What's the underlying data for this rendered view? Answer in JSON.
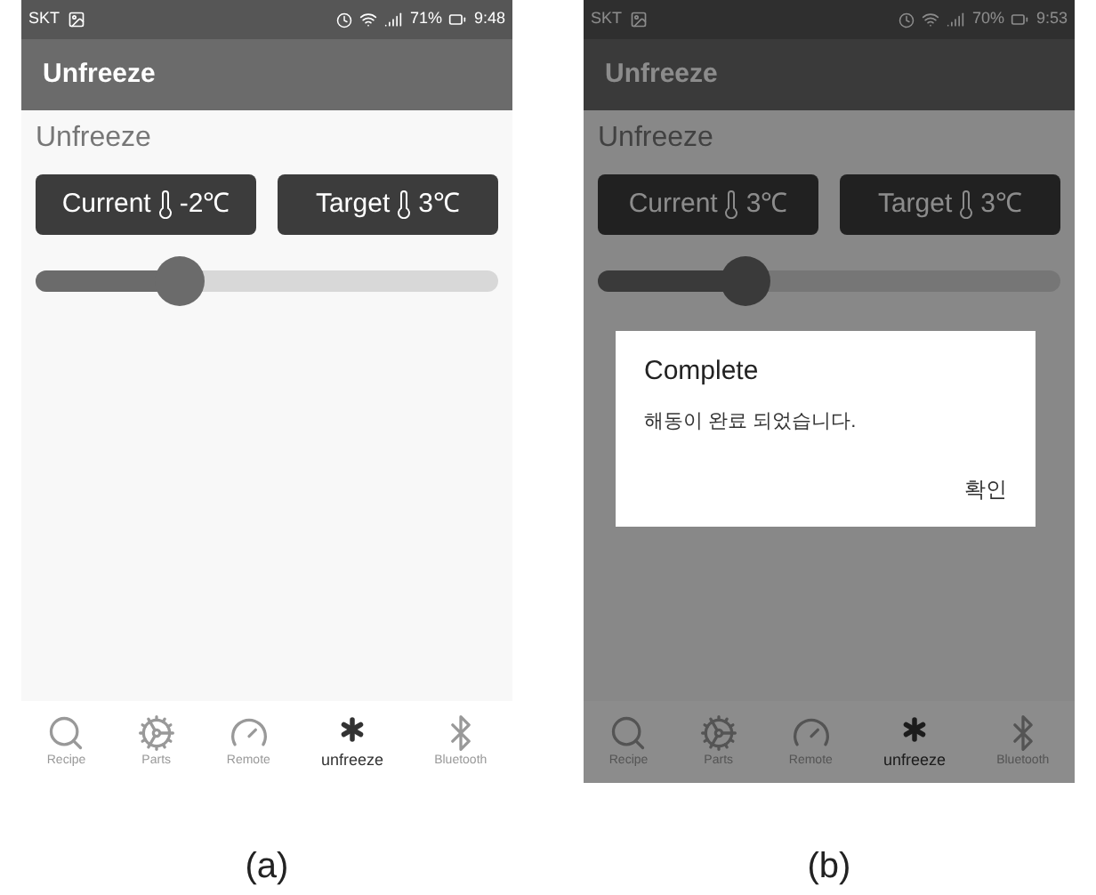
{
  "figures": [
    {
      "caption": "(a)",
      "status_bar": {
        "carrier": "SKT",
        "battery": "71%",
        "time": "9:48"
      },
      "app_bar": {
        "title": "Unfreeze"
      },
      "heading": "Unfreeze",
      "readings": [
        {
          "label": "Current",
          "value": "-2℃"
        },
        {
          "label": "Target",
          "value": "3℃"
        }
      ],
      "slider": {
        "level": 0.31
      },
      "nav": [
        {
          "kind": "search",
          "label": "Recipe",
          "selected": false
        },
        {
          "kind": "gears",
          "label": "Parts",
          "selected": false
        },
        {
          "kind": "gauge",
          "label": "Remote",
          "selected": false
        },
        {
          "kind": "asterisk",
          "label": "unfreeze",
          "selected": true
        },
        {
          "kind": "bluetooth",
          "label": "Bluetooth",
          "selected": false
        }
      ]
    },
    {
      "caption": "(b)",
      "status_bar": {
        "carrier": "SKT",
        "battery": "70%",
        "time": "9:53"
      },
      "app_bar": {
        "title": "Unfreeze"
      },
      "heading": "Unfreeze",
      "readings": [
        {
          "label": "Current",
          "value": "3℃"
        },
        {
          "label": "Target",
          "value": "3℃"
        }
      ],
      "slider": {
        "level": 0.32
      },
      "nav": [
        {
          "kind": "search",
          "label": "Recipe",
          "selected": false
        },
        {
          "kind": "gears",
          "label": "Parts",
          "selected": false
        },
        {
          "kind": "gauge",
          "label": "Remote",
          "selected": false
        },
        {
          "kind": "asterisk",
          "label": "unfreeze",
          "selected": true
        },
        {
          "kind": "bluetooth",
          "label": "Bluetooth",
          "selected": false
        }
      ],
      "dialog": {
        "title": "Complete",
        "message": "해동이 완료 되었습니다.",
        "button": "확인"
      }
    }
  ]
}
